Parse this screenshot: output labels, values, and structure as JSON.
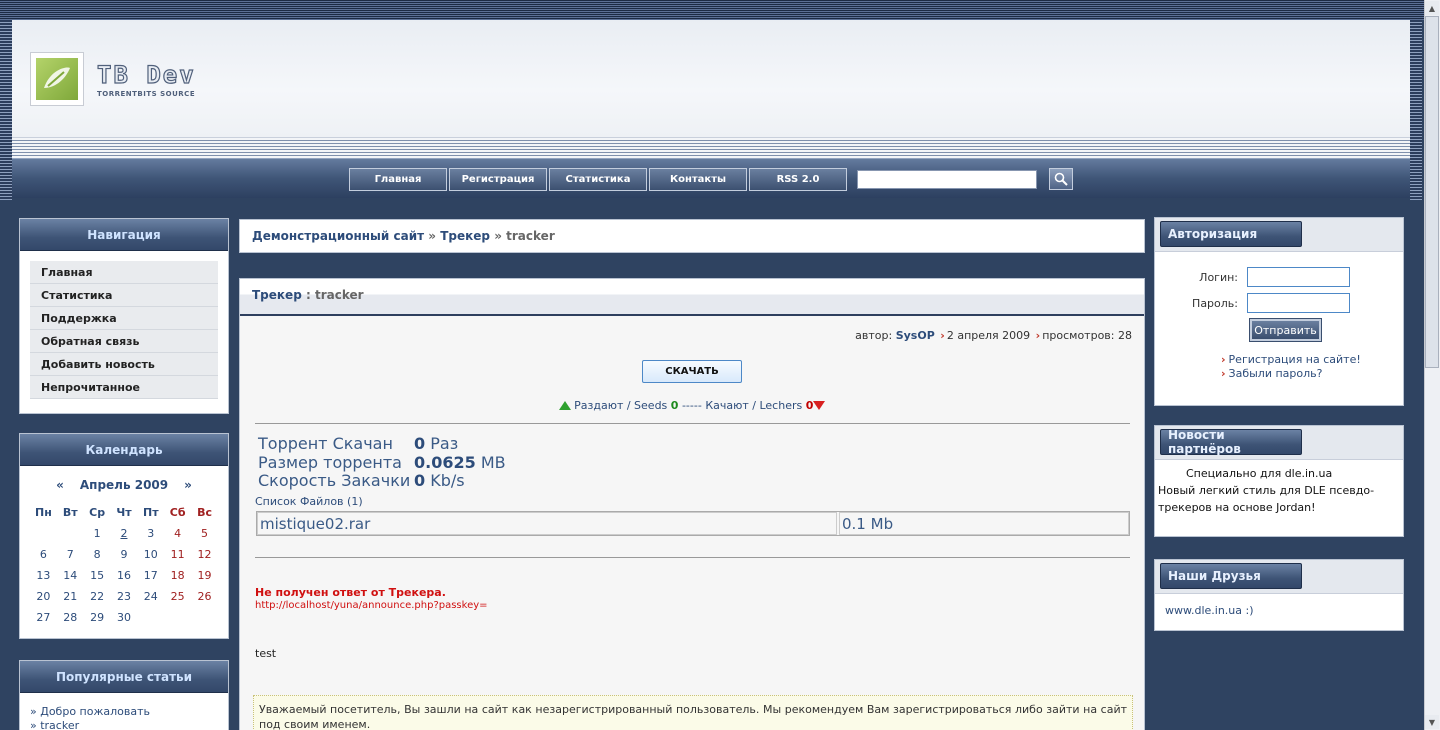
{
  "header": {
    "logo_title": "TB Dev",
    "logo_subtitle": "TORRENTBITS SOURCE",
    "nav": [
      "Главная",
      "Регистрация",
      "Статистика",
      "Контакты",
      "RSS 2.0"
    ],
    "search_value": ""
  },
  "sidebar": {
    "nav_title": "Навигация",
    "nav_items": [
      "Главная",
      "Статистика",
      "Поддержка",
      "Обратная связь",
      "Добавить новость",
      "Непрочитанное"
    ],
    "calendar_title": "Календарь",
    "calendar": {
      "prev": "«",
      "month": "Апрель 2009",
      "next": "»",
      "days": [
        "Пн",
        "Вт",
        "Ср",
        "Чт",
        "Пт",
        "Сб",
        "Вс"
      ],
      "weeks": [
        [
          "",
          "",
          "1",
          "2",
          "3",
          "4",
          "5"
        ],
        [
          "6",
          "7",
          "8",
          "9",
          "10",
          "11",
          "12"
        ],
        [
          "13",
          "14",
          "15",
          "16",
          "17",
          "18",
          "19"
        ],
        [
          "20",
          "21",
          "22",
          "23",
          "24",
          "25",
          "26"
        ],
        [
          "27",
          "28",
          "29",
          "30",
          "",
          "",
          ""
        ]
      ],
      "today": "2"
    },
    "popular_title": "Популярные статьи",
    "popular_items": [
      "» Добро пожаловать",
      "» tracker"
    ]
  },
  "main": {
    "breadcrumb": {
      "site": "Демонстрационный сайт",
      "sep": "»",
      "section": "Трекер",
      "page": "tracker"
    },
    "article_head": {
      "category": "Трекер",
      "sep": " : ",
      "title": "tracker"
    },
    "meta": {
      "author_label": "автор:",
      "author": "SysOP",
      "date": "2 апреля 2009",
      "views_label": "просмотров:",
      "views": "28"
    },
    "download_label": "СКАЧАТЬ",
    "peers": {
      "seeds_label": "Раздают / Seeds",
      "seeds": "0",
      "dash": "-----",
      "leech_label": "Качают / Lechers",
      "leechers": "0"
    },
    "stats": [
      {
        "label": "Торрент Скачан",
        "value": "0",
        "unit": "Раз"
      },
      {
        "label": "Размер торрента",
        "value": "0.0625",
        "unit": "MB"
      },
      {
        "label": "Скорость Закачки",
        "value": "0",
        "unit": "Kb/s"
      }
    ],
    "file_list_label": "Список Файлов (1)",
    "files": [
      {
        "name": "mistique02.rar",
        "size": "0.1 Mb"
      }
    ],
    "error_title": "Не получен ответ от Трекера.",
    "error_url": "http://localhost/yuna/announce.php?passkey=",
    "body_text": "test",
    "notice": "Уважаемый посетитель, Вы зашли на сайт как незарегистрированный пользователь. Мы рекомендуем Вам зарегистрироваться либо зайти на сайт под своим именем."
  },
  "right": {
    "auth_title": "Авторизация",
    "login_label": "Логин:",
    "password_label": "Пароль:",
    "submit_label": "Отправить",
    "register_link": "Регистрация на сайте!",
    "forgot_link": "Забыли пароль?",
    "partners_title": "Новости партнёров",
    "partners_line1": "Специально для dle.in.ua",
    "partners_line2": "Новый легкий стиль для DLE псевдо-трекеров на основе Jordan!",
    "friends_title": "Наши Друзья",
    "friends_link": "www.dle.in.ua :)"
  }
}
